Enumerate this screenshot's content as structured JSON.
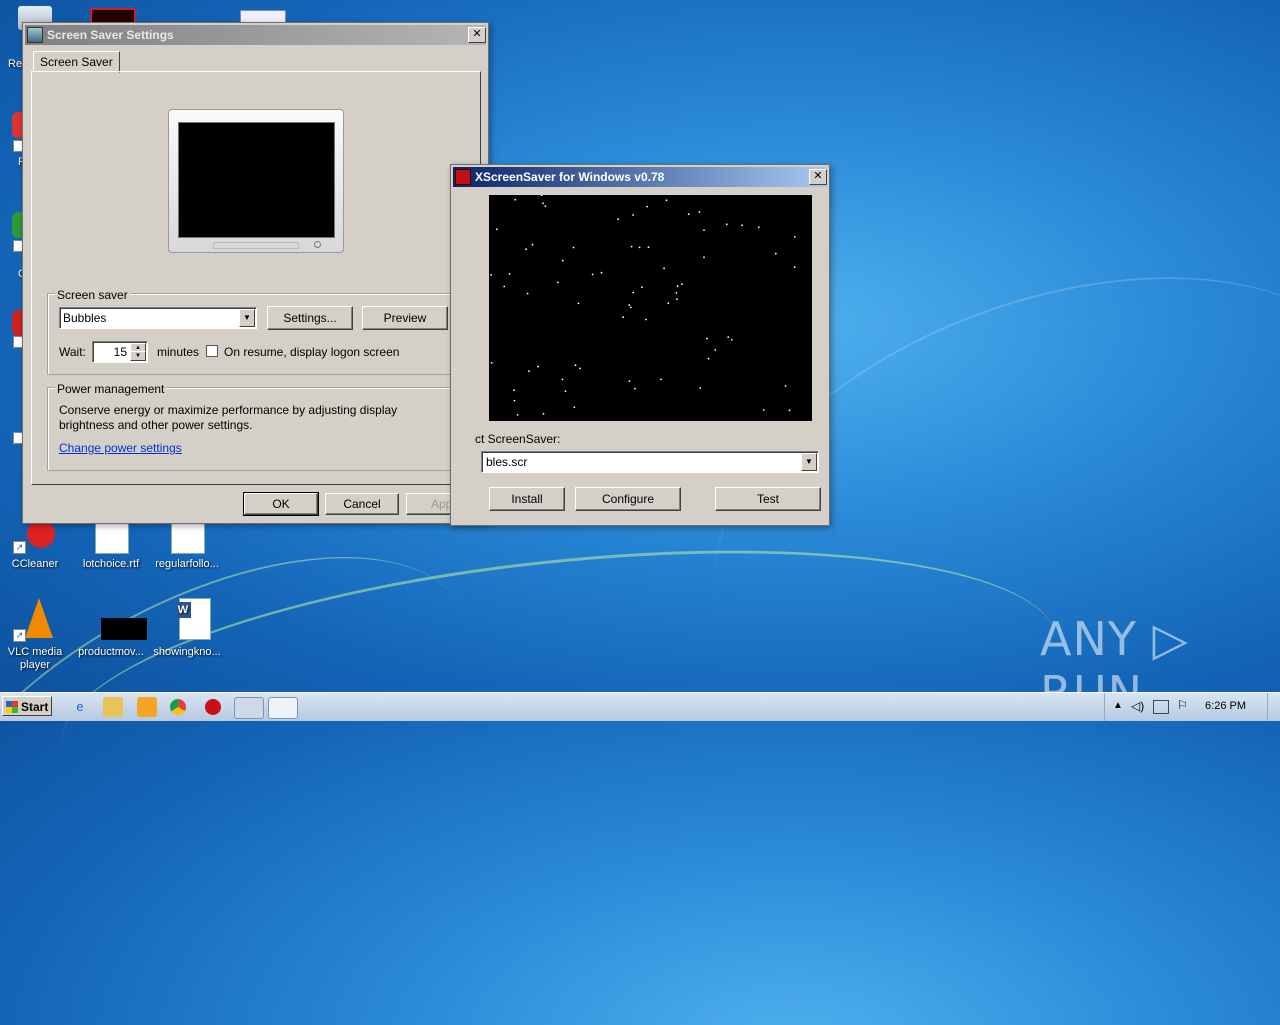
{
  "desktop": {
    "icons": [
      {
        "label": "CCleaner"
      },
      {
        "label": "lotchoice.rtf"
      },
      {
        "label": "regularfollo..."
      },
      {
        "label": "VLC media player"
      },
      {
        "label": "productmov..."
      },
      {
        "label": "showingkno..."
      }
    ],
    "partial_labels": {
      "recycle": "Re",
      "f": "F",
      "c": "C"
    },
    "watermark": "ANY ▷ RUN"
  },
  "ss_settings": {
    "title": "Screen Saver Settings",
    "tab": "Screen Saver",
    "screen_saver_group": "Screen saver",
    "screen_saver_value": "Bubbles",
    "settings_button": "Settings...",
    "preview_button": "Preview",
    "wait_label": "Wait:",
    "wait_value": "15",
    "minutes_label": "minutes",
    "resume_label": "On resume, display logon screen",
    "power_group": "Power management",
    "power_text": "Conserve energy or maximize performance by adjusting display brightness and other power settings.",
    "power_link": "Change power settings",
    "ok_button": "OK",
    "cancel_button": "Cancel",
    "apply_button": "Appl"
  },
  "xscreensaver": {
    "title": "XScreenSaver for Windows v0.78",
    "select_label": "ct ScreenSaver:",
    "select_value": "bles.scr",
    "install_button": "Install",
    "configure_button": "Configure",
    "test_button": "Test"
  },
  "taskbar": {
    "start_label": "Start",
    "clock": "6:26 PM"
  },
  "colors": {
    "titlebar_active": "#0a246a",
    "titlebar_inactive": "#808080",
    "window_face": "#d4d0c8",
    "desktop_blue": "#1f7bd0"
  }
}
